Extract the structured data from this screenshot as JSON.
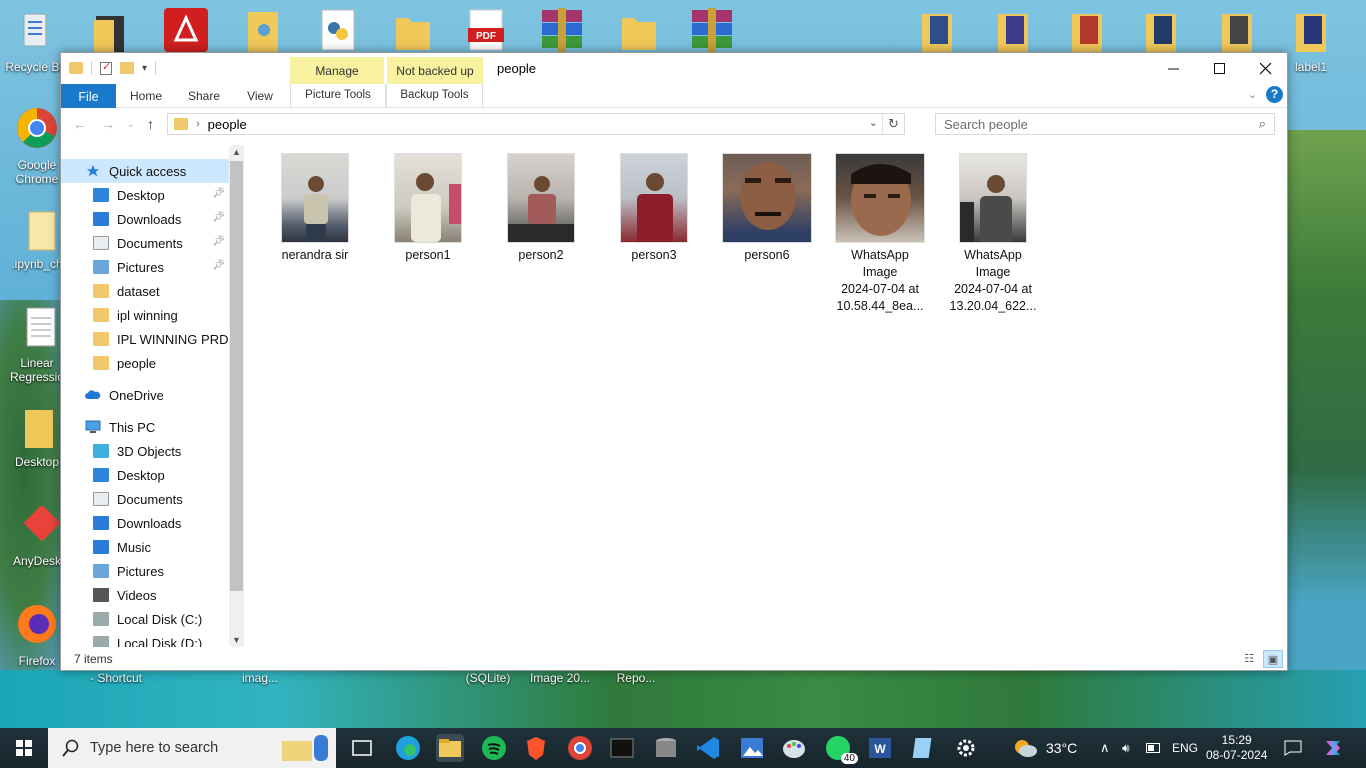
{
  "desktop": {
    "left_icons": [
      {
        "label": "Recycle Bin",
        "icon": "recycle-bin-icon"
      },
      {
        "label": "Google Chrome",
        "icon": "chrome-icon"
      },
      {
        "label": ".ipynb_ch",
        "icon": "file-icon"
      },
      {
        "label": "Linear Regressio",
        "icon": "document-icon"
      },
      {
        "label": "Desktop",
        "icon": "folder-icon"
      },
      {
        "label": "AnyDesk",
        "icon": "anydesk-icon"
      },
      {
        "label": "Firefox",
        "icon": "firefox-icon"
      }
    ],
    "top_right_label": "label1",
    "bottom_labels": [
      "- Shortcut",
      "imag...",
      "(SQLite)",
      "Image 20...",
      "Repo..."
    ]
  },
  "window": {
    "title": "people",
    "context_tabs": {
      "manage": "Manage",
      "not_backed_up": "Not backed up"
    },
    "ribbon_tabs": {
      "file": "File",
      "home": "Home",
      "share": "Share",
      "view": "View",
      "picture_tools": "Picture Tools",
      "backup_tools": "Backup Tools"
    },
    "address": {
      "crumb": "people"
    },
    "search": {
      "placeholder": "Search people"
    },
    "status": {
      "count": "7 items"
    }
  },
  "nav": {
    "quick_access": "Quick access",
    "qa_items": [
      {
        "label": "Desktop",
        "pinned": true,
        "icon": "desktop-icon"
      },
      {
        "label": "Downloads",
        "pinned": true,
        "icon": "downloads-icon"
      },
      {
        "label": "Documents",
        "pinned": true,
        "icon": "documents-icon"
      },
      {
        "label": "Pictures",
        "pinned": true,
        "icon": "pictures-icon"
      },
      {
        "label": "dataset",
        "pinned": false,
        "icon": "folder-icon"
      },
      {
        "label": "ipl winning",
        "pinned": false,
        "icon": "folder-icon"
      },
      {
        "label": "IPL WINNING PRDIC",
        "pinned": false,
        "icon": "folder-icon"
      },
      {
        "label": "people",
        "pinned": false,
        "icon": "folder-icon"
      }
    ],
    "onedrive": "OneDrive",
    "this_pc": "This PC",
    "pc_items": [
      {
        "label": "3D Objects",
        "icon": "3d-objects-icon"
      },
      {
        "label": "Desktop",
        "icon": "desktop-icon"
      },
      {
        "label": "Documents",
        "icon": "documents-icon"
      },
      {
        "label": "Downloads",
        "icon": "downloads-icon"
      },
      {
        "label": "Music",
        "icon": "music-icon"
      },
      {
        "label": "Pictures",
        "icon": "pictures-icon"
      },
      {
        "label": "Videos",
        "icon": "videos-icon"
      },
      {
        "label": "Local Disk (C:)",
        "icon": "drive-icon"
      },
      {
        "label": "Local Disk (D:)",
        "icon": "drive-icon"
      }
    ]
  },
  "files": [
    {
      "name": "nerandra sir",
      "lines": [
        "nerandra sir"
      ]
    },
    {
      "name": "person1",
      "lines": [
        "person1"
      ]
    },
    {
      "name": "person2",
      "lines": [
        "person2"
      ]
    },
    {
      "name": "person3",
      "lines": [
        "person3"
      ]
    },
    {
      "name": "person6",
      "lines": [
        "person6"
      ]
    },
    {
      "name": "WhatsApp Image 2024-07-04 at 10.58.44_8ea...",
      "lines": [
        "WhatsApp",
        "Image",
        "2024-07-04 at",
        "10.58.44_8ea..."
      ]
    },
    {
      "name": "WhatsApp Image 2024-07-04 at 13.20.04_622...",
      "lines": [
        "WhatsApp",
        "Image",
        "2024-07-04 at",
        "13.20.04_622..."
      ]
    }
  ],
  "taskbar": {
    "search_placeholder": "Type here to search",
    "weather": "33°C",
    "lang": "ENG",
    "time": "15:29",
    "date": "08-07-2024",
    "whatsapp_badge": "40"
  }
}
